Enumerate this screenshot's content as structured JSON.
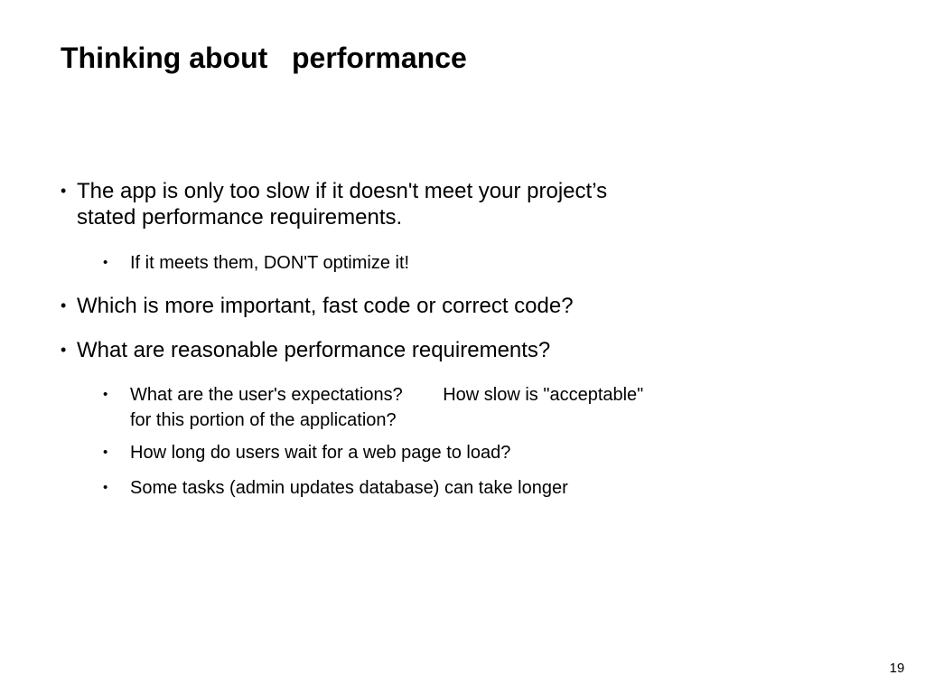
{
  "slide": {
    "title": "Thinking about   performance",
    "bullets": [
      {
        "text": "The app is only too slow if it doesn't meet your project’s  stated performance requirements.",
        "sub": [
          {
            "text": "If it meets them, DON'T optimize it!"
          }
        ]
      },
      {
        "text": "Which is more important, fast code or correct code?",
        "sub": []
      },
      {
        "text": "What are reasonable performance requirements?",
        "sub": [
          {
            "text": "What are the user's expectations?        How slow is \"acceptable\"  for this portion of the application?"
          },
          {
            "text": "How long do users wait for a web page to load?"
          },
          {
            "text": "Some tasks (admin updates database) can take longer"
          }
        ]
      }
    ],
    "bullet_glyph": "•",
    "page_number": "19"
  }
}
